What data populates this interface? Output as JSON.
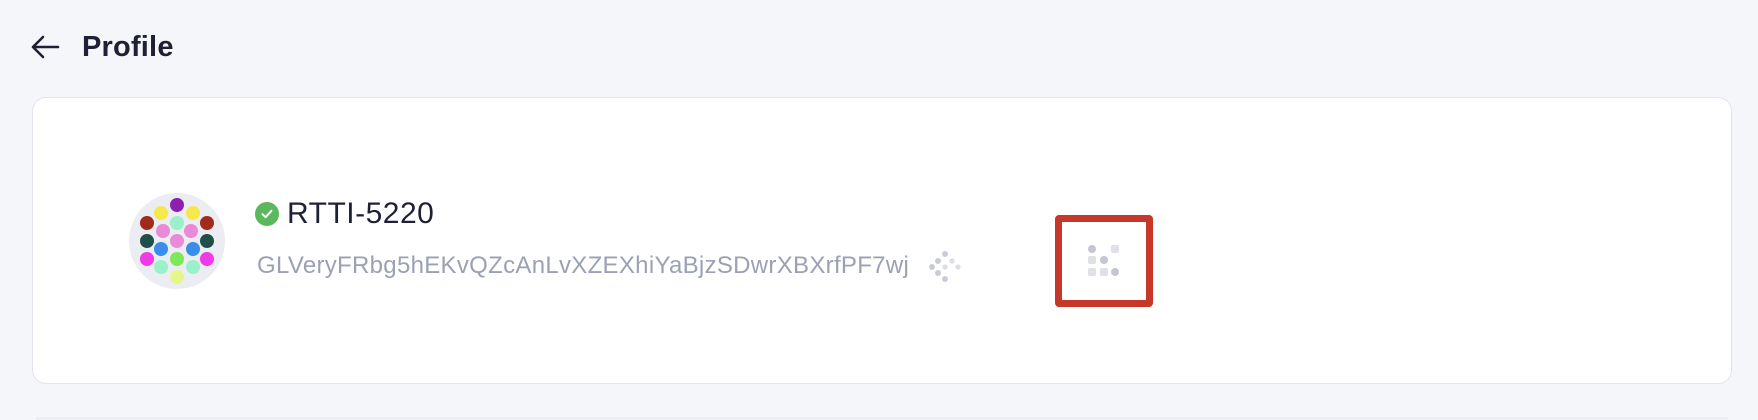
{
  "header": {
    "title": "Profile",
    "back_icon": "arrow-left-icon"
  },
  "profile": {
    "username": "RTTI-5220",
    "verified": true,
    "verified_icon": "check-circle-icon",
    "address": "GLVeryFRbg5hEKvQZcAnLvXZEXhiYaBjzSDwrXBXrfPF7wj",
    "copy_icon": "copy-dots-icon",
    "qr_icon": "qr-code-icon",
    "avatar_icon": "identicon-avatar"
  },
  "colors": {
    "background": "#f5f6fa",
    "card": "#ffffff",
    "verified": "#5cb85c",
    "highlight": "#c8382a",
    "muted_text": "#9ba1b3"
  }
}
